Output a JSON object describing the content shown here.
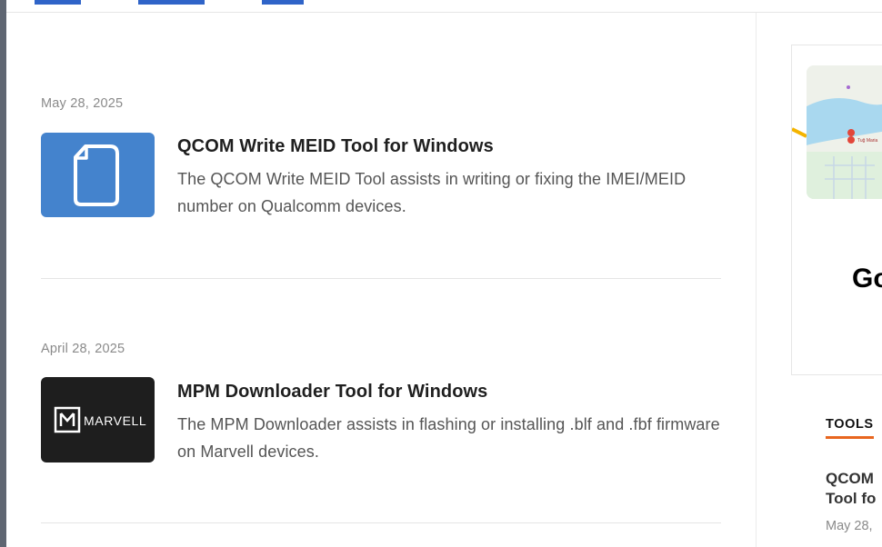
{
  "posts": [
    {
      "date": "May 28, 2025",
      "title": "QCOM Write MEID Tool for Windows",
      "excerpt": "The QCOM Write MEID Tool assists in writing or fixing the IMEI/MEID number on Qualcomm devices.",
      "thumb_icon": "file-icon",
      "thumb_color": "#4483cd"
    },
    {
      "date": "April 28, 2025",
      "title": "MPM Downloader Tool for Windows",
      "excerpt": "The MPM Downloader assists in flashing or installing .blf and .fbf firmware on Marvell devices.",
      "thumb_logo_text": "MARVELL",
      "thumb_color": "#1e1e1e"
    }
  ],
  "sidebar": {
    "ad": {
      "heading": "Go",
      "map_labels": [
        "Tuğ Maria"
      ]
    },
    "widget": {
      "label": "TOOLS",
      "accent": "#e8661f",
      "post_title": "QCOM\nTool fo",
      "post_date": "May 28,"
    }
  },
  "colors": {
    "top_tab": "#2f64c8"
  }
}
